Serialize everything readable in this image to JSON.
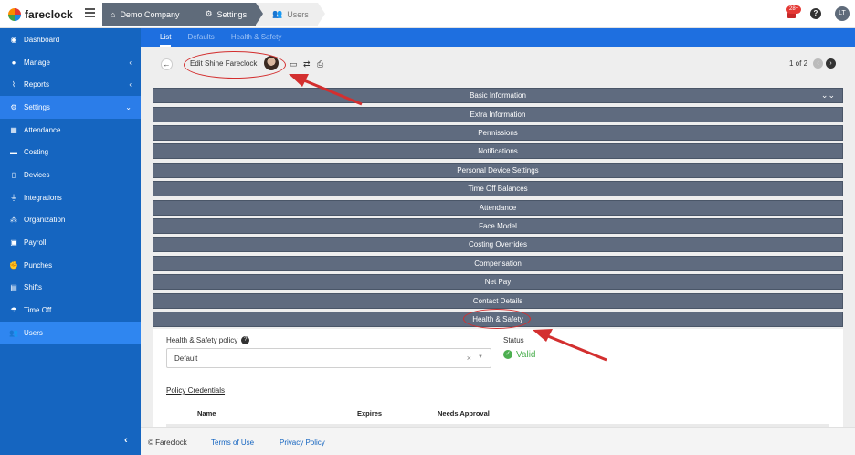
{
  "app": {
    "name": "fareclock"
  },
  "breadcrumbs": [
    "Demo Company",
    "Settings",
    "Users"
  ],
  "topbar": {
    "notification_count": "28+",
    "help_label": "?",
    "user_initials": "LT"
  },
  "sidebar": {
    "items": [
      {
        "label": "Dashboard",
        "icon": "dashboard-icon"
      },
      {
        "label": "Manage",
        "icon": "person-icon",
        "chevron": "‹"
      },
      {
        "label": "Reports",
        "icon": "chart-icon",
        "chevron": "‹"
      },
      {
        "label": "Settings",
        "icon": "gear-icon",
        "chevron": "⌄"
      },
      {
        "label": "Attendance",
        "icon": "attendance-icon"
      },
      {
        "label": "Costing",
        "icon": "costing-icon"
      },
      {
        "label": "Devices",
        "icon": "device-icon"
      },
      {
        "label": "Integrations",
        "icon": "plug-icon"
      },
      {
        "label": "Organization",
        "icon": "org-icon"
      },
      {
        "label": "Payroll",
        "icon": "payroll-icon"
      },
      {
        "label": "Punches",
        "icon": "punch-icon"
      },
      {
        "label": "Shifts",
        "icon": "calendar-icon"
      },
      {
        "label": "Time Off",
        "icon": "beach-icon"
      },
      {
        "label": "Users",
        "icon": "users-icon"
      }
    ],
    "collapse_label": "‹"
  },
  "tabs": [
    "List",
    "Defaults",
    "Health & Safety"
  ],
  "header": {
    "title": "Edit Shine Fareclock",
    "pager": "1 of 2"
  },
  "sections": [
    "Basic Information",
    "Extra Information",
    "Permissions",
    "Notifications",
    "Personal Device Settings",
    "Time Off Balances",
    "Attendance",
    "Face Model",
    "Costing Overrides",
    "Compensation",
    "Net Pay",
    "Contact Details",
    "Health & Safety"
  ],
  "health_safety": {
    "policy_label": "Health & Safety policy",
    "policy_value": "Default",
    "clear_symbol": "×",
    "status_label": "Status",
    "status_value": "Valid",
    "credentials_title": "Policy Credentials",
    "columns": [
      "Name",
      "Expires",
      "Needs Approval"
    ]
  },
  "footer": {
    "copyright": "© Fareclock",
    "terms": "Terms of Use",
    "privacy": "Privacy Policy"
  },
  "colors": {
    "sidebar": "#1565c0",
    "accordion": "#5f6b7f",
    "annotation": "#d32f2f",
    "valid": "#4caf50"
  }
}
